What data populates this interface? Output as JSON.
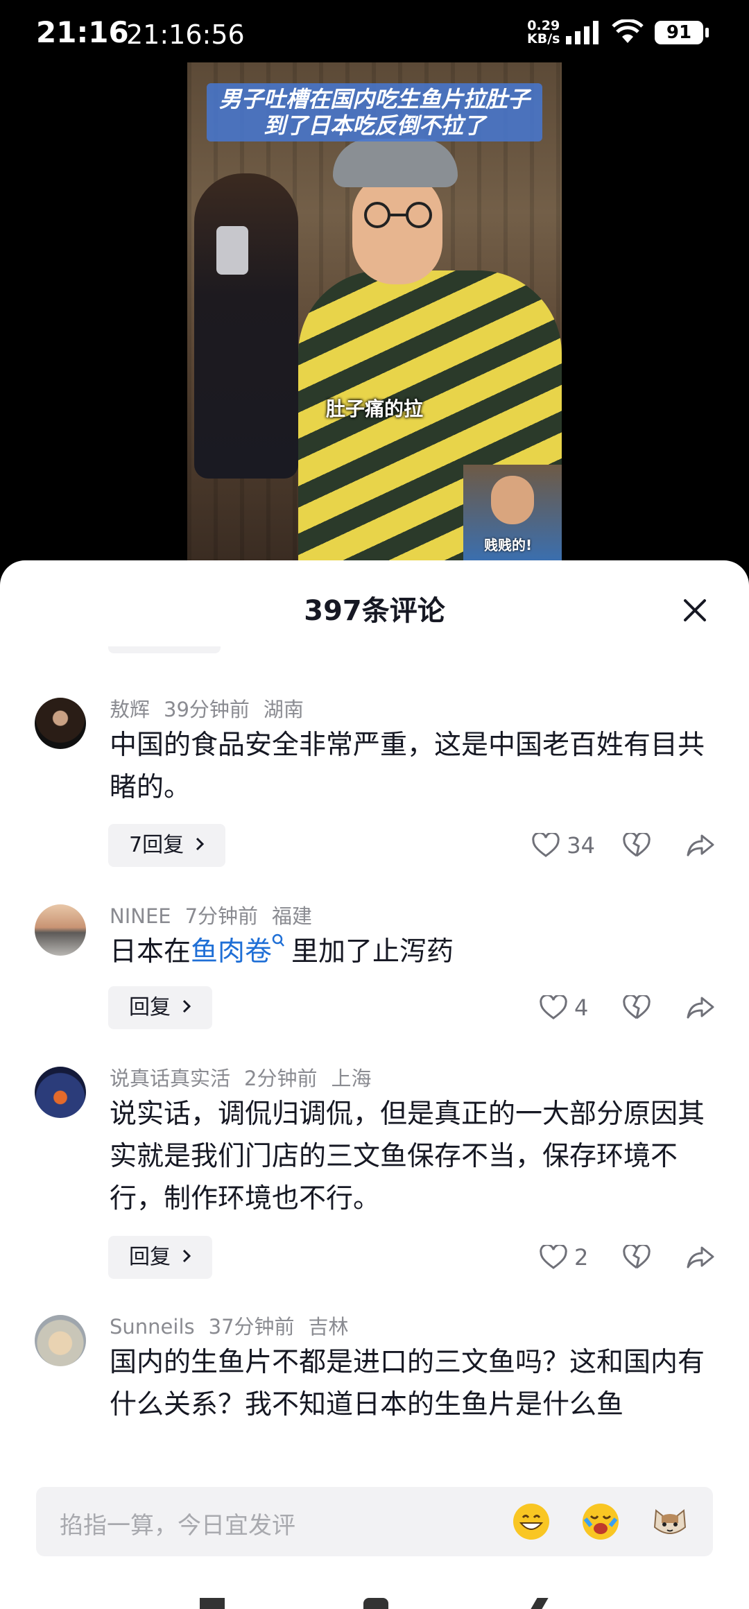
{
  "status": {
    "time": "21:16",
    "time_full": "21:16:56",
    "net_speed": "0.29",
    "net_unit": "KB/s",
    "battery": "91"
  },
  "video": {
    "caption_line1": "男子吐槽在国内吃生鱼片拉肚子",
    "caption_line2": "到了日本吃反倒不拉了",
    "subtitle": "肚子痛的拉",
    "pip_text": "贱贱的!"
  },
  "comments_panel": {
    "title": "397条评论",
    "comments": [
      {
        "user": "敖辉",
        "time": "39分钟前",
        "location": "湖南",
        "text": "中国的食品安全非常严重，这是中国老百姓有目共睹的。",
        "reply_label": "7回复",
        "likes": "34"
      },
      {
        "user": "NINEE",
        "time": "7分钟前",
        "location": "福建",
        "text_before": "日本在",
        "text_link": "鱼肉卷",
        "text_after": "里加了止泻药",
        "reply_label": "回复",
        "likes": "4"
      },
      {
        "user": "说真话真实活",
        "time": "2分钟前",
        "location": "上海",
        "text": "说实话，调侃归调侃，但是真正的一大部分原因其实就是我们门店的三文鱼保存不当，保存环境不行，制作环境也不行。",
        "reply_label": "回复",
        "likes": "2"
      },
      {
        "user": "Sunneils",
        "time": "37分钟前",
        "location": "吉林",
        "text": "国内的生鱼片不都是进口的三文鱼吗？这和国内有什么关系？我不知道日本的生鱼片是什么鱼"
      }
    ],
    "input_placeholder": "掐指一算，今日宜发评"
  },
  "colors": {
    "link": "#1f6fd6",
    "meta": "#8a8b91",
    "text": "#161823"
  }
}
